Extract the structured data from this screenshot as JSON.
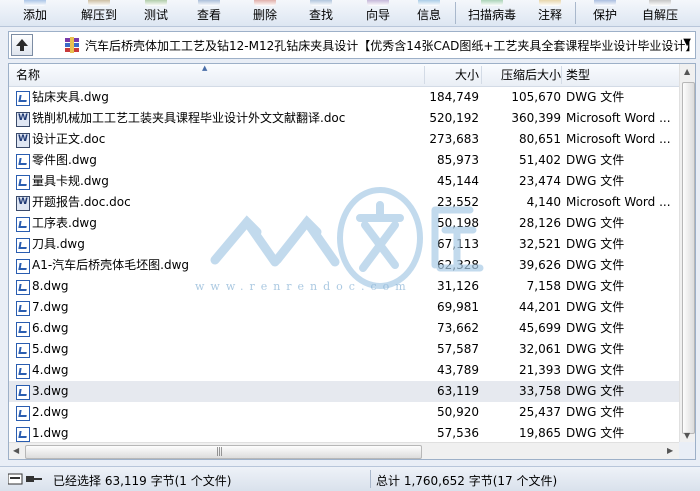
{
  "toolbar": {
    "buttons": [
      {
        "label": "添加",
        "icon": "add-icon",
        "color": "#3c78c8"
      },
      {
        "label": "解压到",
        "icon": "extract-icon",
        "color": "#8a6a2a"
      },
      {
        "label": "测试",
        "icon": "test-icon",
        "color": "#4a8a3a"
      },
      {
        "label": "查看",
        "icon": "view-icon",
        "color": "#3a6aa8"
      },
      {
        "label": "删除",
        "icon": "delete-icon",
        "color": "#b8463a"
      },
      {
        "label": "查找",
        "icon": "find-icon",
        "color": "#4a7ab0"
      },
      {
        "label": "向导",
        "icon": "wizard-icon",
        "color": "#7a5aa8"
      },
      {
        "label": "信息",
        "icon": "info-icon",
        "color": "#3a8ac8"
      },
      {
        "label": "扫描病毒",
        "icon": "virus-scan-icon",
        "color": "#3a9a5a"
      },
      {
        "label": "注释",
        "icon": "comment-icon",
        "color": "#c8a03a"
      },
      {
        "label": "保护",
        "icon": "protect-icon",
        "color": "#3a6ab8"
      },
      {
        "label": "自解压",
        "icon": "sfx-icon",
        "color": "#7a7a7a"
      }
    ]
  },
  "address": {
    "path": "汽车后桥壳体加工工艺及钻12-M12孔钻床夹具设计【优秀含14张CAD图纸+工艺夹具全套课程毕业设计毕业设计】"
  },
  "columns": {
    "name": "名称",
    "size": "大小",
    "packed": "压缩后大小",
    "type": "类型"
  },
  "files": [
    {
      "name": "钻床夹具.dwg",
      "size": "184,749",
      "packed": "105,670",
      "type": "DWG 文件",
      "kind": "dwg"
    },
    {
      "name": "铣削机械加工工艺工装夹具课程毕业设计外文文献翻译.doc",
      "size": "520,192",
      "packed": "360,399",
      "type": "Microsoft Word ...",
      "kind": "word"
    },
    {
      "name": "设计正文.doc",
      "size": "273,683",
      "packed": "80,651",
      "type": "Microsoft Word ...",
      "kind": "word"
    },
    {
      "name": "零件图.dwg",
      "size": "85,973",
      "packed": "51,402",
      "type": "DWG 文件",
      "kind": "dwg"
    },
    {
      "name": "量具卡规.dwg",
      "size": "45,144",
      "packed": "23,474",
      "type": "DWG 文件",
      "kind": "dwg"
    },
    {
      "name": "开题报告.doc.doc",
      "size": "23,552",
      "packed": "4,140",
      "type": "Microsoft Word ...",
      "kind": "word"
    },
    {
      "name": "工序表.dwg",
      "size": "50,198",
      "packed": "28,126",
      "type": "DWG 文件",
      "kind": "dwg"
    },
    {
      "name": "刀具.dwg",
      "size": "67,113",
      "packed": "32,521",
      "type": "DWG 文件",
      "kind": "dwg"
    },
    {
      "name": "A1-汽车后桥壳体毛坯图.dwg",
      "size": "62,328",
      "packed": "39,626",
      "type": "DWG 文件",
      "kind": "dwg"
    },
    {
      "name": "8.dwg",
      "size": "31,126",
      "packed": "7,158",
      "type": "DWG 文件",
      "kind": "dwg"
    },
    {
      "name": "7.dwg",
      "size": "69,981",
      "packed": "44,201",
      "type": "DWG 文件",
      "kind": "dwg"
    },
    {
      "name": "6.dwg",
      "size": "73,662",
      "packed": "45,699",
      "type": "DWG 文件",
      "kind": "dwg"
    },
    {
      "name": "5.dwg",
      "size": "57,587",
      "packed": "32,061",
      "type": "DWG 文件",
      "kind": "dwg"
    },
    {
      "name": "4.dwg",
      "size": "43,789",
      "packed": "21,393",
      "type": "DWG 文件",
      "kind": "dwg"
    },
    {
      "name": "3.dwg",
      "size": "63,119",
      "packed": "33,758",
      "type": "DWG 文件",
      "kind": "dwg",
      "selected": true
    },
    {
      "name": "2.dwg",
      "size": "50,920",
      "packed": "25,437",
      "type": "DWG 文件",
      "kind": "dwg"
    },
    {
      "name": "1.dwg",
      "size": "57,536",
      "packed": "19,865",
      "type": "DWG 文件",
      "kind": "dwg"
    }
  ],
  "watermark": {
    "chars": "人人文库",
    "url": "www.renrendoc.com",
    "color": "#a9cbe6"
  },
  "status": {
    "selected": "已经选择 63,119 字节(1 个文件)",
    "total": "总计 1,760,652 字节(17 个文件)"
  }
}
